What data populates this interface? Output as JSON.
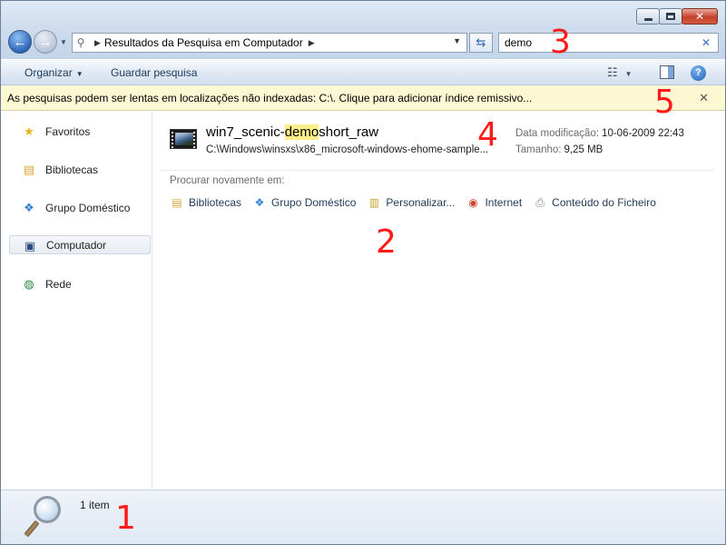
{
  "window": {
    "caption_buttons": {
      "minimize": "minimize",
      "maximize": "maximize",
      "close": "✕"
    }
  },
  "address": {
    "crumb": "Resultados da Pesquisa em Computador",
    "search_value": "demo"
  },
  "toolbar": {
    "organize_label": "Organizar",
    "save_search_label": "Guardar pesquisa"
  },
  "infobar": {
    "message": "As pesquisas podem ser lentas em localizações não indexadas: C:\\. Clique para adicionar índice remissivo..."
  },
  "sidebar": {
    "items": [
      {
        "label": "Favoritos",
        "icon": "star-icon"
      },
      {
        "label": "Bibliotecas",
        "icon": "libraries-icon"
      },
      {
        "label": "Grupo Doméstico",
        "icon": "homegroup-icon"
      },
      {
        "label": "Computador",
        "icon": "computer-icon",
        "selected": true
      },
      {
        "label": "Rede",
        "icon": "network-icon"
      }
    ]
  },
  "result": {
    "title_before": "win7_scenic-",
    "title_match": "demo",
    "title_after": "short_raw",
    "path": "C:\\Windows\\winsxs\\x86_microsoft-windows-ehome-sample...",
    "modified_label": "Data modificação:",
    "modified_value": "10-06-2009 22:43",
    "size_label": "Tamanho:",
    "size_value": "9,25 MB"
  },
  "search_again": {
    "label": "Procurar novamente em:",
    "items": [
      {
        "label": "Bibliotecas",
        "icon": "libraries-icon"
      },
      {
        "label": "Grupo Doméstico",
        "icon": "homegroup-icon"
      },
      {
        "label": "Personalizar...",
        "icon": "custom-folder-icon"
      },
      {
        "label": "Internet",
        "icon": "internet-icon"
      },
      {
        "label": "Conteúdo do Ficheiro",
        "icon": "file-contents-icon"
      }
    ]
  },
  "status": {
    "item_count": "1 item"
  },
  "annotations": [
    "1",
    "2",
    "3",
    "4",
    "5"
  ],
  "colors": {
    "annotation": "#ff1a1a",
    "highlight": "#ffef8a",
    "infobar": "#fcf8d4"
  }
}
